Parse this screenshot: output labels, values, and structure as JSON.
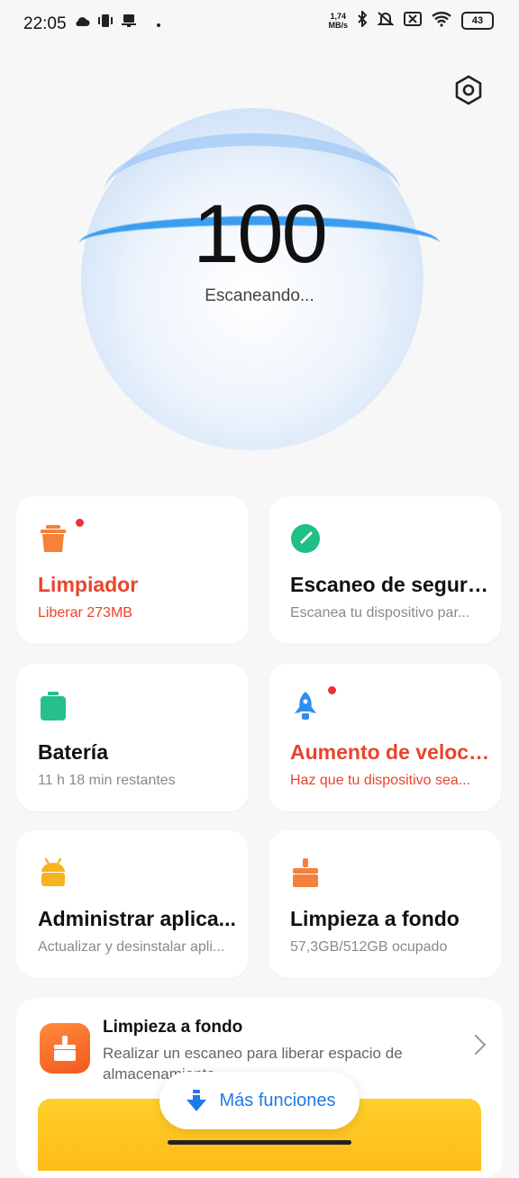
{
  "status_bar": {
    "time": "22:05",
    "net_speed_value": "1,74",
    "net_speed_unit": "MB/s",
    "battery": "43",
    "icons": [
      "cloud-icon",
      "vibrate-icon",
      "notification-icon",
      "bluetooth-icon",
      "silent-icon",
      "sim-icon",
      "wifi-icon",
      "battery-icon"
    ]
  },
  "scan": {
    "score": "100",
    "status": "Escaneando..."
  },
  "cards": [
    {
      "title": "Limpiador",
      "subtitle": "Liberar 273MB",
      "icon": "trash-icon",
      "color": "#f5813a",
      "alert": true
    },
    {
      "title": "Escaneo de seguri...",
      "subtitle": "Escanea tu dispositivo par...",
      "icon": "security-icon",
      "color": "#1fbf86",
      "alert": false
    },
    {
      "title": "Batería",
      "subtitle": "11 h 18 min  restantes",
      "icon": "battery-icon",
      "color": "#27c08a",
      "alert": false
    },
    {
      "title": "Aumento de veloci...",
      "subtitle": "Haz que tu dispositivo sea...",
      "icon": "rocket-icon",
      "color": "#2f8ef0",
      "alert": true
    },
    {
      "title": "Administrar aplica...",
      "subtitle": "Actualizar y desinstalar apli...",
      "icon": "android-icon",
      "color": "#f7b31f",
      "alert": false
    },
    {
      "title": "Limpieza a fondo",
      "subtitle": "57,3GB/512GB ocupado",
      "icon": "broom-icon",
      "color": "#f5813a",
      "alert": false
    }
  ],
  "promo": {
    "title": "Limpieza a fondo",
    "description": "Realizar un escaneo para liberar espacio de almacenamiento"
  },
  "more_button": {
    "label": "Más funciones"
  },
  "colors": {
    "accent_blue": "#1e7ae6",
    "alert_red": "#e8452c",
    "background": "#f7f7f7"
  }
}
